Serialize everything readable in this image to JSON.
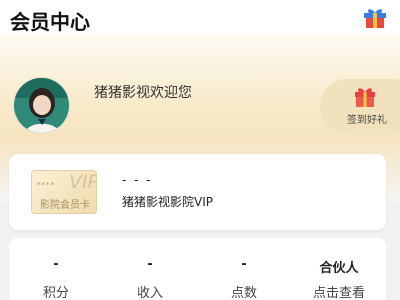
{
  "header": {
    "title": "会员中心",
    "gift_icon": "gift-box-icon"
  },
  "profile": {
    "welcome_text": "猪猪影视欢迎您",
    "avatar": "user-avatar"
  },
  "signin": {
    "label": "签到好礼",
    "icon": "gift-icon"
  },
  "vip": {
    "badge_stars": "****",
    "badge_vip": "VIP",
    "badge_label": "影院会员卡",
    "status": "- - -",
    "name": "猪猪影视影院VIP"
  },
  "stats": [
    {
      "value": "-",
      "label": "积分"
    },
    {
      "value": "-",
      "label": "收入"
    },
    {
      "value": "-",
      "label": "点数"
    },
    {
      "value": "合伙人",
      "label": "点击查看"
    }
  ],
  "colors": {
    "accent_red": "#e8423f",
    "accent_blue": "#4a90e2",
    "gold": "#a58d5e"
  }
}
